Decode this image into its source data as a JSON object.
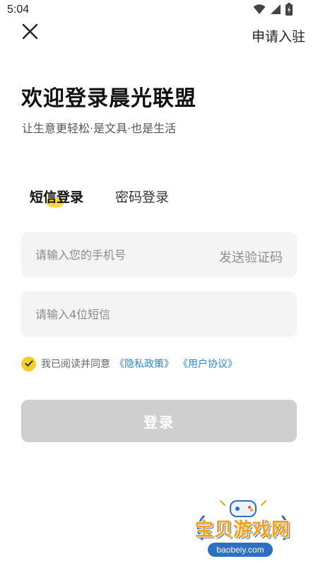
{
  "status_bar": {
    "time": "5:04",
    "icons": [
      "wifi-icon",
      "signal-icon",
      "battery-icon"
    ]
  },
  "header": {
    "close_icon": "close-icon",
    "apply_label": "申请入驻"
  },
  "title": "欢迎登录晨光联盟",
  "subtitle": "让生意更轻松·是文具·也是生活",
  "tabs": [
    {
      "label": "短信登录",
      "active": true
    },
    {
      "label": "密码登录",
      "active": false
    }
  ],
  "phone_input": {
    "value": "",
    "placeholder": "请输入您的手机号",
    "send_code_label": "发送验证码"
  },
  "sms_input": {
    "value": "",
    "placeholder": "请输入4位短信"
  },
  "agreement": {
    "checked": true,
    "text": "我已阅读并同意",
    "privacy_link": "《隐私政策》",
    "user_link": "《用户协议》"
  },
  "login_button": {
    "label": "登录"
  },
  "watermark": {
    "text": "宝贝游戏网",
    "sub": "baobeiy.com"
  },
  "colors": {
    "accent": "#f6ce2b",
    "link": "#2b86d9",
    "button_disabled": "#cfcfcf",
    "field_bg": "#f4f4f4"
  }
}
